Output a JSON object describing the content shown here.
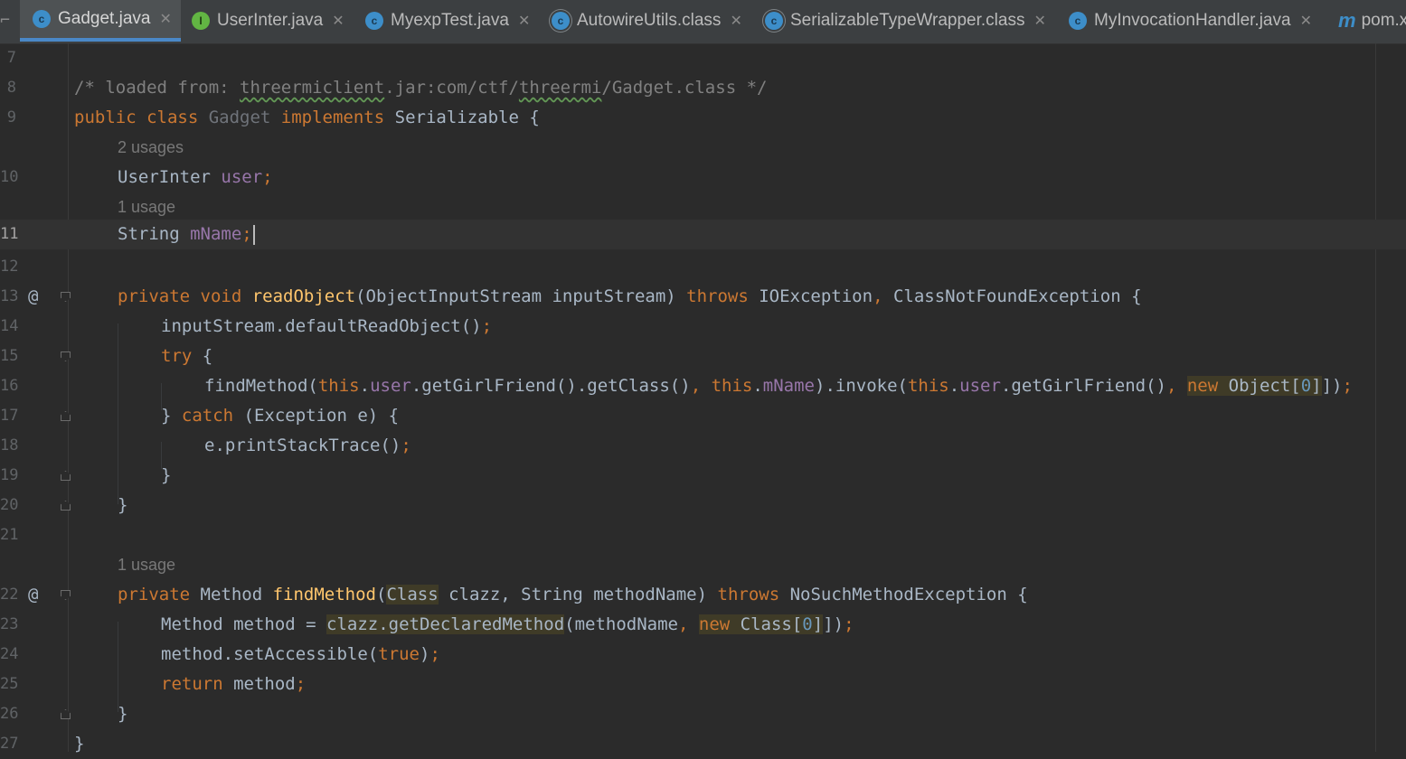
{
  "tabs": [
    {
      "label": "Gadget.java",
      "icon": "java-class-icon",
      "active": true
    },
    {
      "label": "UserInter.java",
      "icon": "interface-icon",
      "active": false
    },
    {
      "label": "MyexpTest.java",
      "icon": "java-class-icon",
      "active": false
    },
    {
      "label": "AutowireUtils.class",
      "icon": "compiled-class-icon",
      "active": false
    },
    {
      "label": "SerializableTypeWrapper.class",
      "icon": "compiled-class-icon",
      "active": false
    },
    {
      "label": "MyInvocationHandler.java",
      "icon": "java-class-icon",
      "active": false
    },
    {
      "label": "pom.x",
      "icon": "maven-icon",
      "active": false
    }
  ],
  "editor": {
    "current_line": "11",
    "line_numbers": [
      "7",
      "8",
      "9",
      "",
      "10",
      "",
      "11",
      "12",
      "13",
      "14",
      "15",
      "16",
      "17",
      "18",
      "19",
      "20",
      "21",
      "",
      "22",
      "23",
      "24",
      "25",
      "26",
      "27"
    ],
    "hints": {
      "user_usages": "2 usages",
      "mname_usages": "1 usage",
      "findmethod_usages": "1 usage"
    },
    "lines": {
      "l8_comment_a": "/* loaded from: ",
      "l8_comment_jar": "threermiclient",
      "l8_comment_b": ".jar:com/ctf/",
      "l8_comment_pkg": "threermi",
      "l8_comment_c": "/Gadget.class */",
      "l9_public": "public class ",
      "l9_class": "Gadget",
      "l9_implements": " implements ",
      "l9_rest": "Serializable {",
      "l10_type": "UserInter ",
      "l10_field": "user",
      "l11_type": "String ",
      "l11_field": "mName",
      "l13_mod": "private void ",
      "l13_fn": "readObject",
      "l13_params": "(ObjectInputStream inputStream) ",
      "l13_throws": "throws",
      "l13_ex1": " IOException",
      "l13_ex2": " ClassNotFoundException {",
      "l14": "inputStream.defaultReadObject()",
      "l15_try": "try",
      "l15_rest": " {",
      "l16_a": "findMethod(",
      "l16_this1": "this",
      "l16_user1": "user",
      "l16_b": ".getGirlFriend().getClass()",
      "l16_this2": "this",
      "l16_mname": "mName",
      "l16_c": ").invoke(",
      "l16_this3": "this",
      "l16_user2": "user",
      "l16_d": ".getGirlFriend()",
      "l16_new": "new",
      "l16_obj": " Object[",
      "l16_zero": "0",
      "l16_end": "])",
      "l17_a": "} ",
      "l17_catch": "catch",
      "l17_b": " (Exception e) {",
      "l18": "e.printStackTrace()",
      "l19": "}",
      "l20": "}",
      "l22_mod": "private ",
      "l22_type": "Method ",
      "l22_fn": "findMethod",
      "l22_paren": "(",
      "l22_class": "Class",
      "l22_params": " clazz, String methodName) ",
      "l22_throws": "throws",
      "l22_ex": " NoSuchMethodException {",
      "l23_a": "Method method = ",
      "l23_call": "clazz.getDeclaredMethod",
      "l23_b": "(methodName",
      "l23_new": "new",
      "l23_cls": " Class[",
      "l23_zero": "0",
      "l23_end": "])",
      "l24_a": "method.setAccessible(",
      "l24_true": "true",
      "l24_b": ")",
      "l25_return": "return",
      "l25_b": " method",
      "l26": "}",
      "l27": "}"
    }
  },
  "colors": {
    "background": "#2b2b2b",
    "keyword": "#cc7832",
    "function": "#ffc66d",
    "field": "#9876aa",
    "number": "#6897bb",
    "comment": "#808080",
    "text": "#a9b7c6",
    "active_tab_underline": "#4a88c7"
  }
}
